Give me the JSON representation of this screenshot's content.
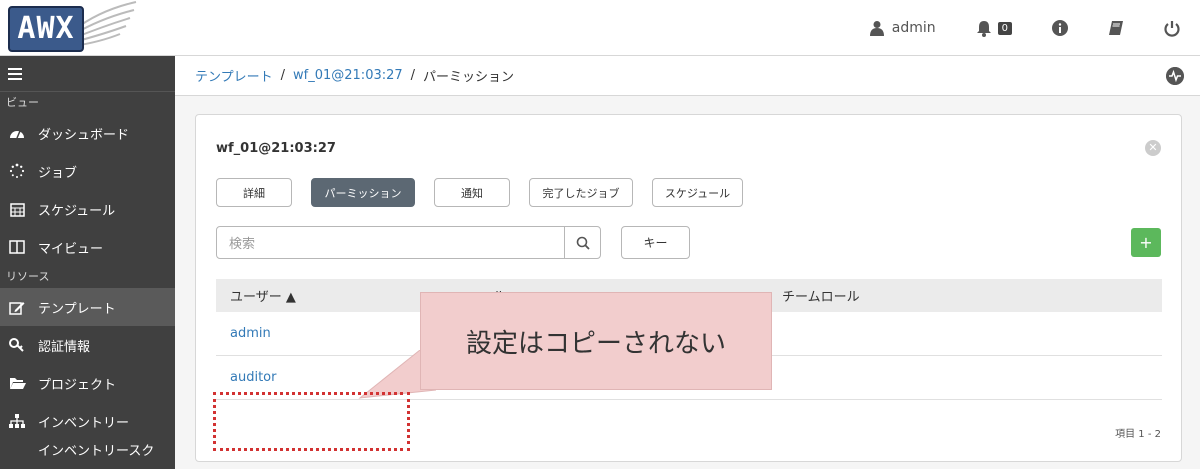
{
  "logo": {
    "text": "AWX"
  },
  "topbar": {
    "user_label": "admin",
    "notification_count": "0",
    "icons": [
      "user-icon",
      "bell-icon",
      "info-icon",
      "book-icon",
      "power-icon"
    ]
  },
  "sidebar": {
    "sections": [
      {
        "title": "ビュー",
        "items": [
          {
            "label": "ダッシュボード",
            "icon": "dashboard-icon"
          },
          {
            "label": "ジョブ",
            "icon": "spinner-icon"
          },
          {
            "label": "スケジュール",
            "icon": "calendar-icon"
          },
          {
            "label": "マイビュー",
            "icon": "columns-icon"
          }
        ]
      },
      {
        "title": "リソース",
        "items": [
          {
            "label": "テンプレート",
            "icon": "edit-icon",
            "active": true
          },
          {
            "label": "認証情報",
            "icon": "key-icon"
          },
          {
            "label": "プロジェクト",
            "icon": "folder-icon"
          },
          {
            "label": "インベントリー",
            "icon": "sitemap-icon"
          },
          {
            "label": "インベントリースク",
            "icon": ""
          }
        ]
      }
    ]
  },
  "breadcrumb": {
    "items": [
      "テンプレート",
      "wf_01@21:03:27",
      "パーミッション"
    ],
    "separator": "/"
  },
  "panel": {
    "title": "wf_01@21:03:27",
    "tabs": [
      {
        "label": "詳細"
      },
      {
        "label": "パーミッション",
        "active": true
      },
      {
        "label": "通知"
      },
      {
        "label": "完了したジョブ"
      },
      {
        "label": "スケジュール"
      }
    ],
    "search_placeholder": "検索",
    "key_label": "キー",
    "add_label": "+",
    "table": {
      "headers": [
        "ユーザー ▲",
        "ロール",
        "チームロール"
      ],
      "rows": [
        {
          "user": "admin"
        },
        {
          "user": "auditor"
        }
      ]
    },
    "pager": "項目 1 - 2"
  },
  "annotation": {
    "text": "設定はコピーされない"
  }
}
